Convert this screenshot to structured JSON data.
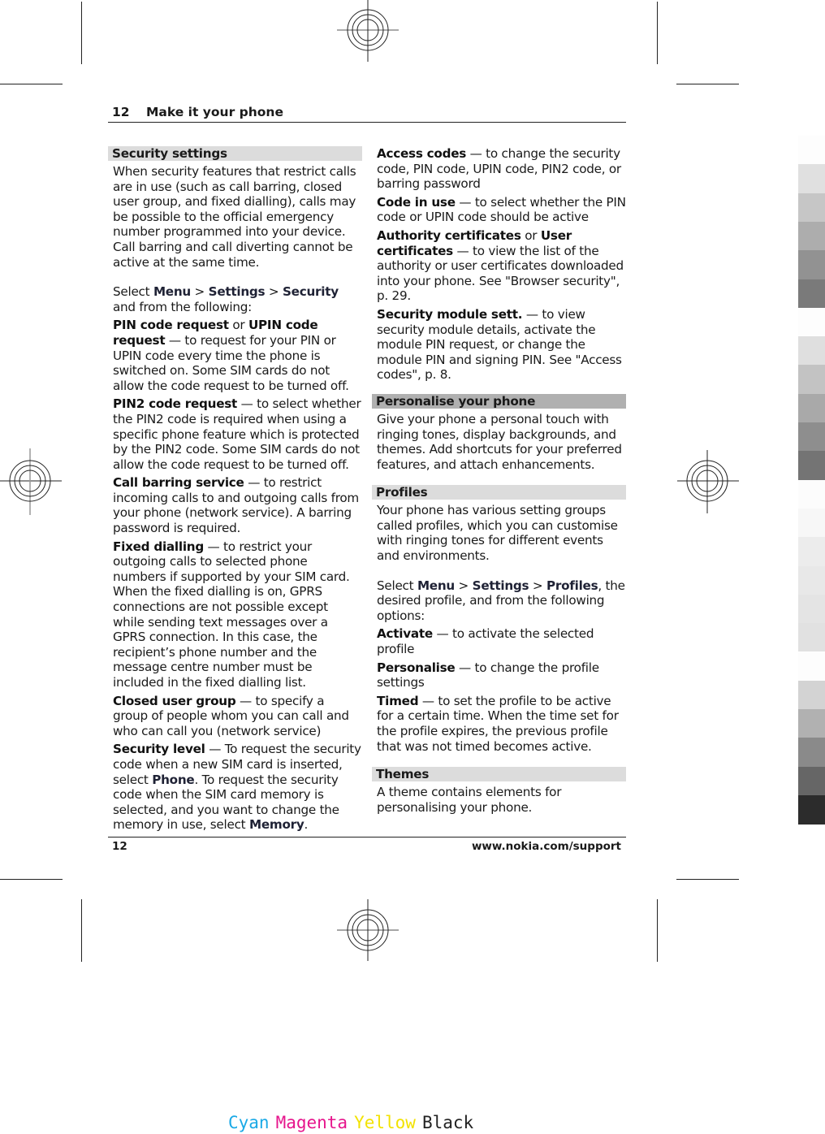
{
  "running_head": {
    "page_number": "12",
    "chapter_title": "Make it your phone"
  },
  "footer": {
    "page_number": "12",
    "url": "www.nokia.com/support"
  },
  "left_column": {
    "security_settings": {
      "heading": "Security settings",
      "intro": "When security features that restrict calls are in use (such as call barring, closed user group, and fixed dialling), calls may be possible to the official emergency number programmed into your device. Call barring and call diverting cannot be active at the same time.",
      "select_prefix": "Select ",
      "path": [
        "Menu",
        "Settings",
        "Security"
      ],
      "path_sep": " > ",
      "select_suffix": " and from the following:",
      "options": [
        {
          "term": "PIN code request",
          "joiner": " or ",
          "term2": "UPIN code request",
          "desc": " — to request for your PIN or UPIN code every time the phone is switched on. Some SIM cards do not allow the code request to be turned off."
        },
        {
          "term": "PIN2 code request",
          "desc": "  — to select whether the PIN2 code is required when using a specific phone feature which is protected by the PIN2 code. Some SIM cards do not allow the code request to be turned off."
        },
        {
          "term": "Call barring service",
          "desc": "  — to restrict incoming calls to and outgoing calls from your phone (network service). A barring password is required."
        },
        {
          "term": "Fixed dialling",
          "desc": "  — to restrict your outgoing calls to selected phone numbers if supported by your SIM card. When the fixed dialling is on, GPRS connections are not possible except while sending text messages over a GPRS connection. In this case, the recipient’s phone number and the message centre number must be included in the fixed dialling list."
        },
        {
          "term": "Closed user group",
          "desc": "  — to specify a group of people whom you can call and who can call you (network service)"
        }
      ],
      "security_level": {
        "term": "Security level",
        "desc1": "  — To request the security code when a new SIM card is inserted, select ",
        "kw1": "Phone",
        "desc2": ". To request the security code when the SIM card memory is selected, and you want to change the memory in use, select ",
        "kw2": "Memory",
        "desc3": "."
      }
    }
  },
  "right_column": {
    "security_options": [
      {
        "term": "Access codes",
        "desc": "  — to change the security code, PIN code, UPIN code, PIN2 code, or barring password"
      },
      {
        "term": "Code in use",
        "desc": "  — to select whether the PIN code or UPIN code should be active"
      },
      {
        "term": "Authority certificates",
        "joiner": " or ",
        "term2": "User certificates",
        "desc": " — to view the list of the authority or user certificates downloaded into your phone. See \"Browser security\", p. 29."
      },
      {
        "term": "Security module sett.",
        "desc": "  — to view security module details, activate the module PIN request, or change the module PIN and signing PIN. See \"Access codes\", p. 8."
      }
    ],
    "personalise": {
      "heading": "Personalise your phone",
      "body": "Give your phone a personal touch with ringing tones, display backgrounds, and themes. Add shortcuts for your preferred features, and attach enhancements."
    },
    "profiles": {
      "heading": "Profiles",
      "intro": "Your phone has various setting groups called profiles, which you can customise with ringing tones for different events and environments.",
      "select_prefix": "Select ",
      "path": [
        "Menu",
        "Settings",
        "Profiles"
      ],
      "path_sep": " > ",
      "select_suffix": ", the desired profile, and from the following options:",
      "options": [
        {
          "term": "Activate",
          "desc": "  — to activate the selected profile"
        },
        {
          "term": "Personalise",
          "desc": "  — to change the profile settings"
        },
        {
          "term": "Timed",
          "desc": "  — to set the profile to be active for a certain time. When the time set for the profile expires, the previous profile that was not timed becomes active."
        }
      ]
    },
    "themes": {
      "heading": "Themes",
      "body": "A theme contains elements for personalising your phone."
    }
  },
  "print_marks": {
    "color_labels": [
      {
        "label": "Cyan",
        "color": "#1aa9e6"
      },
      {
        "label": "Magenta",
        "color": "#e6158c"
      },
      {
        "label": "Yellow",
        "color": "#f2e200"
      },
      {
        "label": "Black",
        "color": "#222222"
      }
    ],
    "gray_scale": [
      "#fdfdfd",
      "#e0e0e0",
      "#c6c6c6",
      "#adadad",
      "#929292",
      "#7a7a7a",
      "#fdfdfd",
      "#dfdfdf",
      "#c3c3c3",
      "#a9a9a9",
      "#8e8e8e",
      "#747474",
      "#fcfcfc",
      "#f7f7f7",
      "#ececec",
      "#e8e8e8",
      "#e4e4e4",
      "#e1e1e1",
      "#fdfdfd",
      "#d3d3d3",
      "#b1b1b1",
      "#8a8a8a",
      "#666666",
      "#2c2c2c"
    ]
  }
}
